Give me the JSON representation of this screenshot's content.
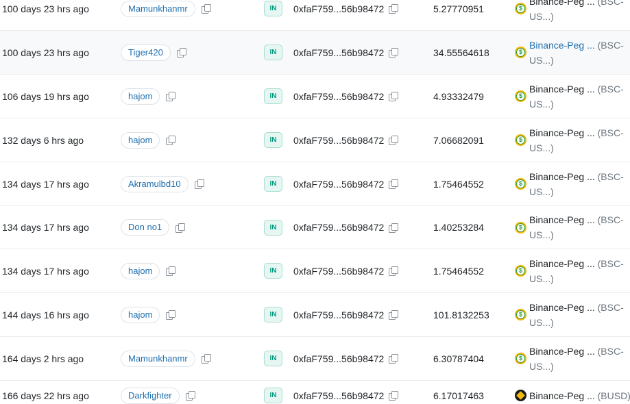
{
  "rows": [
    {
      "age": "100 days 23 hrs ago",
      "from": "Mamunkhanmr",
      "direction": "IN",
      "to": "0xfaF759...56b98472",
      "amount": "5.27770951",
      "token_name": "Binance-Peg ...",
      "token_symbol_line1": "(BSC-",
      "token_symbol_line2": "US...)",
      "token_icon": "busd-dollar-icon"
    },
    {
      "age": "100 days 23 hrs ago",
      "from": "Tiger420",
      "direction": "IN",
      "to": "0xfaF759...56b98472",
      "amount": "34.55564618",
      "token_name": "Binance-Peg ...",
      "token_symbol_line1": "(BSC-",
      "token_symbol_line2": "US...)",
      "token_icon": "busd-dollar-icon"
    },
    {
      "age": "106 days 19 hrs ago",
      "from": "hajom",
      "direction": "IN",
      "to": "0xfaF759...56b98472",
      "amount": "4.93332479",
      "token_name": "Binance-Peg ...",
      "token_symbol_line1": "(BSC-",
      "token_symbol_line2": "US...)",
      "token_icon": "busd-dollar-icon"
    },
    {
      "age": "132 days 6 hrs ago",
      "from": "hajom",
      "direction": "IN",
      "to": "0xfaF759...56b98472",
      "amount": "7.06682091",
      "token_name": "Binance-Peg ...",
      "token_symbol_line1": "(BSC-",
      "token_symbol_line2": "US...)",
      "token_icon": "busd-dollar-icon"
    },
    {
      "age": "134 days 17 hrs ago",
      "from": "Akramulbd10",
      "direction": "IN",
      "to": "0xfaF759...56b98472",
      "amount": "1.75464552",
      "token_name": "Binance-Peg ...",
      "token_symbol_line1": "(BSC-",
      "token_symbol_line2": "US...)",
      "token_icon": "busd-dollar-icon"
    },
    {
      "age": "134 days 17 hrs ago",
      "from": "Don no1",
      "direction": "IN",
      "to": "0xfaF759...56b98472",
      "amount": "1.40253284",
      "token_name": "Binance-Peg ...",
      "token_symbol_line1": "(BSC-",
      "token_symbol_line2": "US...)",
      "token_icon": "busd-dollar-icon"
    },
    {
      "age": "134 days 17 hrs ago",
      "from": "hajom",
      "direction": "IN",
      "to": "0xfaF759...56b98472",
      "amount": "1.75464552",
      "token_name": "Binance-Peg ...",
      "token_symbol_line1": "(BSC-",
      "token_symbol_line2": "US...)",
      "token_icon": "busd-dollar-icon"
    },
    {
      "age": "144 days 16 hrs ago",
      "from": "hajom",
      "direction": "IN",
      "to": "0xfaF759...56b98472",
      "amount": "101.8132253",
      "token_name": "Binance-Peg ...",
      "token_symbol_line1": "(BSC-",
      "token_symbol_line2": "US...)",
      "token_icon": "busd-dollar-icon"
    },
    {
      "age": "164 days 2 hrs ago",
      "from": "Mamunkhanmr",
      "direction": "IN",
      "to": "0xfaF759...56b98472",
      "amount": "6.30787404",
      "token_name": "Binance-Peg ...",
      "token_symbol_line1": "(BSC-",
      "token_symbol_line2": "US...)",
      "token_icon": "busd-dollar-icon"
    },
    {
      "age": "166 days 22 hrs ago",
      "from": "Darkfighter",
      "direction": "IN",
      "to": "0xfaF759...56b98472",
      "amount": "6.17017463",
      "token_name": "Binance-Peg ...",
      "token_symbol_line1": "(BUSD)",
      "token_symbol_line2": "",
      "token_icon": "bnb-token-icon"
    }
  ],
  "colors": {
    "link": "#1e6fb0",
    "in_badge": "#02977e",
    "in_badge_bg": "#e6f7f3",
    "row_alt": "#f8f9fa",
    "border": "#e9ecef"
  }
}
